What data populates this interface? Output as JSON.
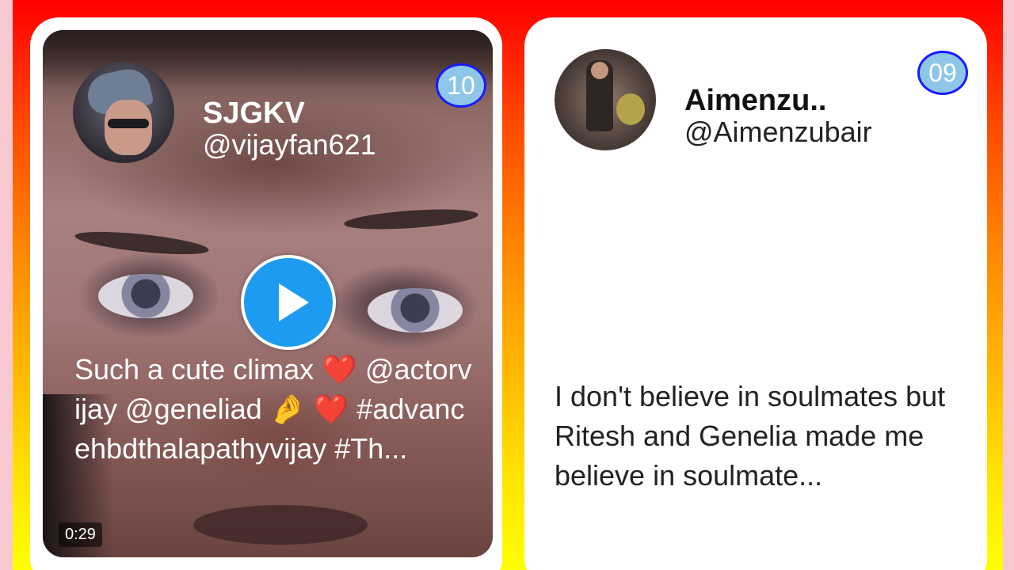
{
  "cards": [
    {
      "type": "video",
      "name": "SJGKV",
      "handle": "@vijayfan621",
      "badge": "10",
      "text": "Such a cute climax ❤️ @actorvijay @geneliad 🤌 ❤️ #advancehbdthalapathyvijay #Th...",
      "duration": "0:29",
      "avatar_icon": "user-avatar-cap"
    },
    {
      "type": "text",
      "name": "Aimenzu..",
      "handle": "@Aimenzubair",
      "badge": "09",
      "text": "I don't believe in soulmates but Ritesh and Genelia made me believe in soulmate...",
      "avatar_icon": "user-avatar-woman"
    }
  ],
  "colors": {
    "background_top": "#ff0000",
    "background_bottom": "#ffff00",
    "badge_fill": "#8ec6e8",
    "badge_border": "#1a1aff",
    "play_button": "#1d9bf0"
  }
}
